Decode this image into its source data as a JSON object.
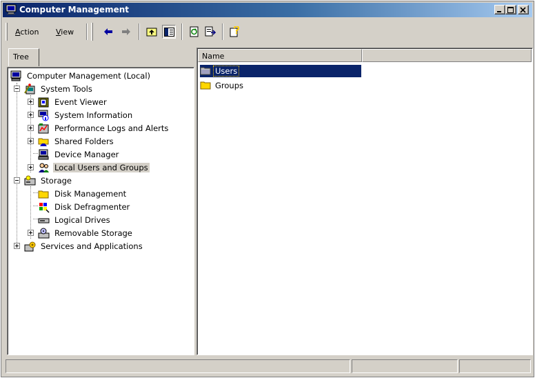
{
  "window": {
    "title": "Computer Management",
    "minimize_icon": "minimize-icon",
    "maximize_icon": "maximize-icon",
    "close_icon": "close-icon"
  },
  "menu": {
    "action": {
      "mnemonic": "A",
      "rest": "ction"
    },
    "view": {
      "mnemonic": "V",
      "rest": "iew"
    }
  },
  "toolbar": {
    "buttons": [
      "back-arrow-icon",
      "forward-arrow-icon",
      "up-one-level-icon",
      "show-hide-tree-icon",
      "refresh-icon",
      "export-list-icon",
      "help-icon"
    ]
  },
  "tabs": {
    "tree": "Tree"
  },
  "tree": {
    "items": [
      {
        "label": "Computer Management (Local)",
        "icon": "computer-management-icon"
      },
      {
        "label": "System Tools",
        "icon": "system-tools-icon"
      },
      {
        "label": "Event Viewer",
        "icon": "event-viewer-icon"
      },
      {
        "label": "System Information",
        "icon": "system-information-icon"
      },
      {
        "label": "Performance Logs and Alerts",
        "icon": "performance-logs-icon"
      },
      {
        "label": "Shared Folders",
        "icon": "shared-folders-icon"
      },
      {
        "label": "Device Manager",
        "icon": "device-manager-icon"
      },
      {
        "label": "Local Users and Groups",
        "icon": "local-users-groups-icon",
        "selected": true
      },
      {
        "label": "Storage",
        "icon": "storage-icon"
      },
      {
        "label": "Disk Management",
        "icon": "disk-management-icon"
      },
      {
        "label": "Disk Defragmenter",
        "icon": "disk-defragmenter-icon"
      },
      {
        "label": "Logical Drives",
        "icon": "logical-drives-icon"
      },
      {
        "label": "Removable Storage",
        "icon": "removable-storage-icon"
      },
      {
        "label": "Services and Applications",
        "icon": "services-applications-icon"
      }
    ]
  },
  "list": {
    "columns": [
      "Name",
      ""
    ],
    "rows": [
      {
        "label": "Users",
        "icon": "users-folder-icon",
        "selected": true
      },
      {
        "label": "Groups",
        "icon": "groups-folder-icon",
        "selected": false
      }
    ]
  },
  "statusbar": {
    "cells": [
      "",
      "",
      ""
    ]
  },
  "colors": {
    "title_gradient_start": "#0a246a",
    "title_gradient_end": "#a6caf0",
    "face": "#d4d0c8",
    "selection": "#0a246a"
  }
}
